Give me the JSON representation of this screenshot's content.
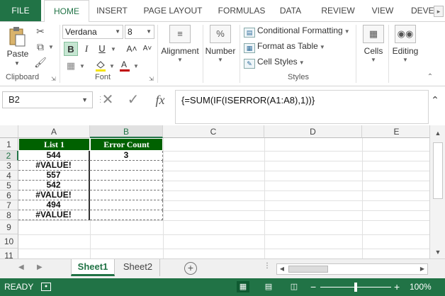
{
  "ribbon_tabs": [
    "FILE",
    "HOME",
    "INSERT",
    "PAGE LAYOUT",
    "FORMULAS",
    "DATA",
    "REVIEW",
    "VIEW",
    "DEVEL"
  ],
  "active_tab": "HOME",
  "clipboard": {
    "paste_label": "Paste",
    "group_label": "Clipboard"
  },
  "font": {
    "name": "Verdana",
    "size": "8",
    "group_label": "Font"
  },
  "alignment": {
    "label": "Alignment"
  },
  "number": {
    "label": "Number",
    "icon": "%"
  },
  "styles": {
    "conditional_formatting": "Conditional Formatting",
    "format_as_table": "Format as Table",
    "cell_styles": "Cell Styles",
    "group_label": "Styles"
  },
  "cells": {
    "label": "Cells"
  },
  "editing": {
    "label": "Editing"
  },
  "formula_bar": {
    "name_box": "B2",
    "formula": "{=SUM(IF(ISERROR(A1:A8),1))}",
    "fx_label": "fx"
  },
  "columns": [
    "A",
    "B",
    "C",
    "D",
    "E"
  ],
  "rows": [
    "1",
    "2",
    "3",
    "4",
    "5",
    "6",
    "7",
    "8",
    "9",
    "10",
    "11"
  ],
  "table": {
    "header_a": "List 1",
    "header_b": "Error Count",
    "list_values": [
      "544",
      "#VALUE!",
      "557",
      "542",
      "#VALUE!",
      "494",
      "#VALUE!"
    ],
    "error_count": "3"
  },
  "sheets": [
    "Sheet1",
    "Sheet2"
  ],
  "active_sheet": "Sheet1",
  "status": {
    "ready": "READY",
    "zoom": "100%",
    "zoom_fraction": 0.5
  },
  "colors": {
    "excel_green": "#217346",
    "header_fill": "#006100",
    "header_text": "#ffffff"
  }
}
